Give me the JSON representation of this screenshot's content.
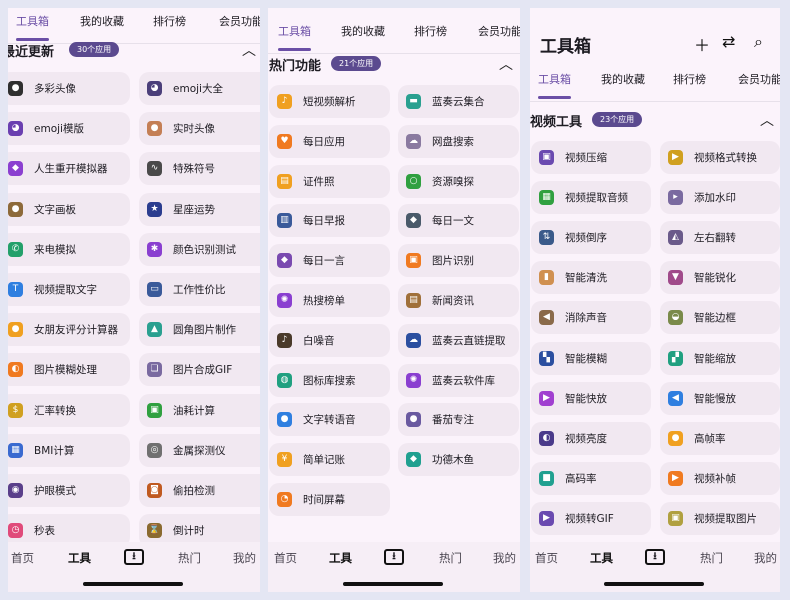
{
  "colors": {
    "accent": "#6b4fa6",
    "badge": "#5b4a8f",
    "card": "#f1e8f1",
    "screen": "#fbf3fb"
  },
  "tabs": [
    "工具箱",
    "我的收藏",
    "排行榜",
    "会员功能"
  ],
  "bottom_nav": {
    "home": "首页",
    "tools": "工具",
    "download_icon": "download-icon",
    "hot": "热门",
    "mine": "我的"
  },
  "screen1": {
    "section_title": "最近更新",
    "badge": "30个应用",
    "items": [
      {
        "label": "多彩头像",
        "icon": "github-icon",
        "color": "#2f2f2f",
        "glyph": "●"
      },
      {
        "label": "emoji大全",
        "icon": "pacman-icon",
        "color": "#4b3f7a",
        "glyph": "◕"
      },
      {
        "label": "emoji模版",
        "icon": "pacman-icon",
        "color": "#6a3fb0",
        "glyph": "◕"
      },
      {
        "label": "实时头像",
        "icon": "avatar-icon",
        "color": "#c47f55",
        "glyph": "●"
      },
      {
        "label": "人生重开模拟器",
        "icon": "ghost-icon",
        "color": "#8b3fd0",
        "glyph": "◆"
      },
      {
        "label": "特殊符号",
        "icon": "pulse-icon",
        "color": "#4a4a4a",
        "glyph": "∿"
      },
      {
        "label": "文字画板",
        "icon": "palette-icon",
        "color": "#8d6a3a",
        "glyph": "●"
      },
      {
        "label": "星座运势",
        "icon": "star-icon",
        "color": "#2b3d8f",
        "glyph": "★"
      },
      {
        "label": "来电模拟",
        "icon": "phone-icon",
        "color": "#23a06a",
        "glyph": "✆"
      },
      {
        "label": "颜色识别测试",
        "icon": "asterisk-icon",
        "color": "#8a3fd0",
        "glyph": "✱"
      },
      {
        "label": "视频提取文字",
        "icon": "video-text-icon",
        "color": "#2f7fe0",
        "glyph": "T"
      },
      {
        "label": "工作性价比",
        "icon": "monitor-icon",
        "color": "#3a5a9a",
        "glyph": "▭"
      },
      {
        "label": "女朋友评分计算器",
        "icon": "chat-icon",
        "color": "#f0a020",
        "glyph": "●"
      },
      {
        "label": "圆角图片制作",
        "icon": "image-icon",
        "color": "#2aa090",
        "glyph": "▲"
      },
      {
        "label": "图片模糊处理",
        "icon": "blur-icon",
        "color": "#f07a20",
        "glyph": "◐"
      },
      {
        "label": "图片合成GIF",
        "icon": "layers-icon",
        "color": "#7a6aa0",
        "glyph": "❏"
      },
      {
        "label": "汇率转换",
        "icon": "currency-icon",
        "color": "#d0a020",
        "glyph": "$"
      },
      {
        "label": "油耗计算",
        "icon": "fuel-icon",
        "color": "#30a040",
        "glyph": "▣"
      },
      {
        "label": "BMI计算",
        "icon": "calculator-icon",
        "color": "#3a6ad0",
        "glyph": "▦"
      },
      {
        "label": "金属探测仪",
        "icon": "target-icon",
        "color": "#707070",
        "glyph": "◎"
      },
      {
        "label": "护眼模式",
        "icon": "eye-icon",
        "color": "#5a3f8a",
        "glyph": "◉"
      },
      {
        "label": "偷拍检测",
        "icon": "camera-icon",
        "color": "#c05a20",
        "glyph": "◙"
      },
      {
        "label": "秒表",
        "icon": "stopwatch-icon",
        "color": "#e04a7a",
        "glyph": "◷"
      },
      {
        "label": "倒计时",
        "icon": "hourglass-icon",
        "color": "#8a6a30",
        "glyph": "⌛"
      }
    ]
  },
  "screen2": {
    "section_title": "热门功能",
    "badge": "21个应用",
    "items": [
      {
        "label": "短视频解析",
        "icon": "tiktok-icon",
        "color": "#f0a020",
        "glyph": "♪"
      },
      {
        "label": "蓝奏云集合",
        "icon": "folder-icon",
        "color": "#2aa090",
        "glyph": "▬"
      },
      {
        "label": "每日应用",
        "icon": "folder-heart-icon",
        "color": "#f07a20",
        "glyph": "♥"
      },
      {
        "label": "网盘搜索",
        "icon": "cloud-upload-icon",
        "color": "#8a7aa0",
        "glyph": "☁"
      },
      {
        "label": "证件照",
        "icon": "id-card-icon",
        "color": "#f0a020",
        "glyph": "▤"
      },
      {
        "label": "资源嗅探",
        "icon": "search-icon",
        "color": "#30a040",
        "glyph": "○"
      },
      {
        "label": "每日早报",
        "icon": "book-icon",
        "color": "#3a5a9a",
        "glyph": "▥"
      },
      {
        "label": "每日一文",
        "icon": "leaf-icon",
        "color": "#4a5a6a",
        "glyph": "◆"
      },
      {
        "label": "每日一言",
        "icon": "leaf-icon",
        "color": "#7a4ab0",
        "glyph": "◆"
      },
      {
        "label": "图片识别",
        "icon": "scan-icon",
        "color": "#f07a20",
        "glyph": "▣"
      },
      {
        "label": "热搜榜单",
        "icon": "bulb-icon",
        "color": "#8a3fd0",
        "glyph": "✺"
      },
      {
        "label": "新闻资讯",
        "icon": "news-icon",
        "color": "#a0703a",
        "glyph": "▤"
      },
      {
        "label": "白噪音",
        "icon": "music-icon",
        "color": "#4a3a2a",
        "glyph": "♪"
      },
      {
        "label": "蓝奏云直链提取",
        "icon": "cloud-icon",
        "color": "#2b4fa0",
        "glyph": "☁"
      },
      {
        "label": "图标库搜索",
        "icon": "globe-icon",
        "color": "#20a080",
        "glyph": "◍"
      },
      {
        "label": "蓝奏云软件库",
        "icon": "bulb-icon",
        "color": "#8a3fd0",
        "glyph": "✺"
      },
      {
        "label": "文字转语音",
        "icon": "mic-icon",
        "color": "#2f7fe0",
        "glyph": "●"
      },
      {
        "label": "番茄专注",
        "icon": "tomato-icon",
        "color": "#6a5aa0",
        "glyph": "●"
      },
      {
        "label": "简单记账",
        "icon": "yen-icon",
        "color": "#f0a020",
        "glyph": "¥"
      },
      {
        "label": "功德木鱼",
        "icon": "fish-icon",
        "color": "#20a090",
        "glyph": "◆"
      },
      {
        "label": "时间屏幕",
        "icon": "clock-icon",
        "color": "#f07a20",
        "glyph": "◔"
      }
    ]
  },
  "screen3": {
    "app_title": "工具箱",
    "header_icons": [
      "add-icon",
      "swap-icon",
      "search-icon"
    ],
    "section_title": "视频工具",
    "badge": "23个应用",
    "items": [
      {
        "label": "视频压缩",
        "icon": "compress-icon",
        "color": "#6a4ab0",
        "glyph": "▣"
      },
      {
        "label": "视频格式转换",
        "icon": "file-video-icon",
        "color": "#d0a020",
        "glyph": "▶"
      },
      {
        "label": "视频提取音频",
        "icon": "film-icon",
        "color": "#30a040",
        "glyph": "▦"
      },
      {
        "label": "添加水印",
        "icon": "watermark-icon",
        "color": "#7a6aa0",
        "glyph": "▸"
      },
      {
        "label": "视频倒序",
        "icon": "sort-icon",
        "color": "#3a5a8a",
        "glyph": "⇅"
      },
      {
        "label": "左右翻转",
        "icon": "flip-icon",
        "color": "#6a5a8a",
        "glyph": "◭"
      },
      {
        "label": "智能清洗",
        "icon": "spray-icon",
        "color": "#d09050",
        "glyph": "▮"
      },
      {
        "label": "智能锐化",
        "icon": "triangle-icon",
        "color": "#a04a8a",
        "glyph": "▼"
      },
      {
        "label": "消除声音",
        "icon": "mute-icon",
        "color": "#8a6a4a",
        "glyph": "◀"
      },
      {
        "label": "智能边框",
        "icon": "frame-icon",
        "color": "#7a8a4a",
        "glyph": "◒"
      },
      {
        "label": "智能模糊",
        "icon": "grid-icon",
        "color": "#2b4fa0",
        "glyph": "▚"
      },
      {
        "label": "智能缩放",
        "icon": "zoom-icon",
        "color": "#20a080",
        "glyph": "▞"
      },
      {
        "label": "智能快放",
        "icon": "fast-forward-icon",
        "color": "#a03fd0",
        "glyph": "▶"
      },
      {
        "label": "智能慢放",
        "icon": "slow-motion-icon",
        "color": "#2f7fe0",
        "glyph": "◀"
      },
      {
        "label": "视频亮度",
        "icon": "brightness-icon",
        "color": "#4a3a8a",
        "glyph": "◐"
      },
      {
        "label": "高帧率",
        "icon": "people-icon",
        "color": "#f0a020",
        "glyph": "●"
      },
      {
        "label": "高码率",
        "icon": "video-camera-icon",
        "color": "#20a090",
        "glyph": "■"
      },
      {
        "label": "视频补帧",
        "icon": "play-icon",
        "color": "#f07a20",
        "glyph": "▶"
      },
      {
        "label": "视频转GIF",
        "icon": "gif-icon",
        "color": "#6a4ab0",
        "glyph": "▶"
      },
      {
        "label": "视频提取图片",
        "icon": "image-extract-icon",
        "color": "#b0a040",
        "glyph": "▣"
      }
    ]
  }
}
